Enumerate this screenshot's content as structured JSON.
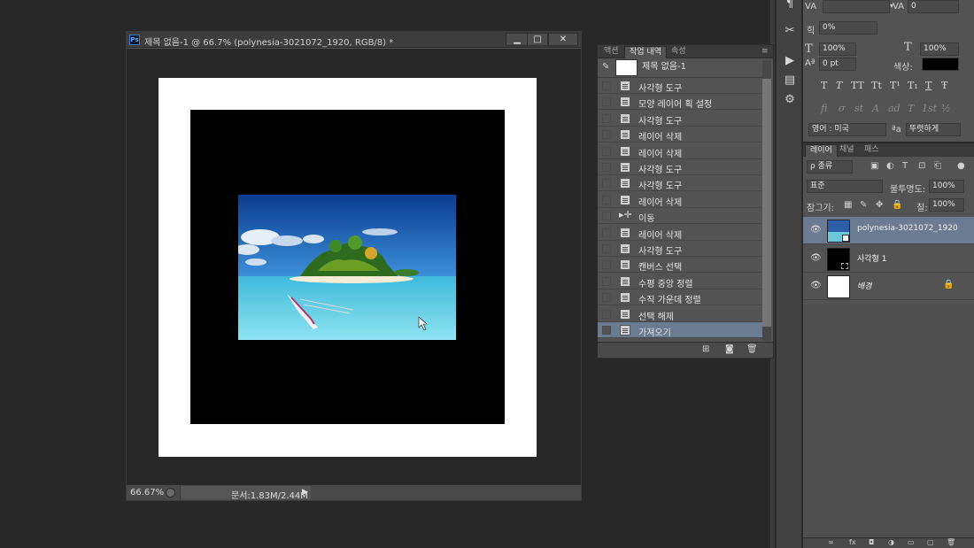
{
  "document": {
    "title": "제목 없음-1 @ 66.7% (polynesia-3021072_1920, RGB/8) *",
    "app_badge": "Ps",
    "minimize": "▁",
    "restore": "□",
    "close": "✕",
    "zoom": "66.67%",
    "doc_info": "문서:1.83M/2.44M",
    "status_arrow": "▶"
  },
  "history_panel": {
    "tabs": [
      "액션",
      "작업 내역",
      "속성"
    ],
    "active_tab": "작업 내역",
    "menu_icon": "≡",
    "snapshot_label": "제목 없음-1",
    "items": [
      {
        "label": "사각형 도구",
        "icon": "document-icon"
      },
      {
        "label": "모양 레이어 획 설정",
        "icon": "document-icon"
      },
      {
        "label": "사각형 도구",
        "icon": "document-icon"
      },
      {
        "label": "레이어 삭제",
        "icon": "document-icon"
      },
      {
        "label": "레이어 삭제",
        "icon": "document-icon"
      },
      {
        "label": "사각형 도구",
        "icon": "document-icon"
      },
      {
        "label": "사각형 도구",
        "icon": "document-icon"
      },
      {
        "label": "레이어 삭제",
        "icon": "document-icon"
      },
      {
        "label": "이동",
        "icon": "move-icon"
      },
      {
        "label": "레이어 삭제",
        "icon": "document-icon"
      },
      {
        "label": "사각형 도구",
        "icon": "document-icon"
      },
      {
        "label": "캔버스 선택",
        "icon": "document-icon"
      },
      {
        "label": "수평 중앙 정렬",
        "icon": "document-icon"
      },
      {
        "label": "수직 가운데 정렬",
        "icon": "document-icon"
      },
      {
        "label": "선택 해제",
        "icon": "document-icon"
      },
      {
        "label": "가져오기",
        "icon": "document-icon"
      }
    ],
    "selected_index": 15
  },
  "character_panel": {
    "tracking_label": "VA",
    "tracking_value": "0",
    "scale_percent": "0%",
    "vertical_scale": "100%",
    "horizontal_scale": "100%",
    "baseline_shift": "0 pt",
    "color_label": "색상:",
    "text_color": "#000000",
    "type_buttons": [
      "T",
      "T",
      "TT",
      "Tt",
      "T¹",
      "T₁",
      "T",
      "Ŧ"
    ],
    "opentype_buttons": [
      "fi",
      "σ",
      "st",
      "A",
      "ad",
      "T",
      "1st",
      "½"
    ],
    "language": "영어 : 미국",
    "aa_label": "ªa",
    "antialias": "뚜렷하게"
  },
  "layers_panel": {
    "tabs": [
      "레이어",
      "채널",
      "패스"
    ],
    "filter_label": "ρ 종류",
    "blend_mode": "표준",
    "opacity_label": "불투명도:",
    "opacity": "100%",
    "lock_label": "잠그기:",
    "fill_label": "칠:",
    "fill": "100%",
    "layers": [
      {
        "name": "polynesia-3021072_1920",
        "type": "smart-object",
        "visible": true,
        "selected": true
      },
      {
        "name": "사각형 1",
        "type": "shape",
        "visible": true,
        "selected": false
      },
      {
        "name": "배경",
        "type": "background",
        "visible": true,
        "selected": false,
        "locked": true
      }
    ],
    "footer_icons": [
      "link-icon",
      "fx-icon",
      "mask-icon",
      "adjustment-icon",
      "group-icon",
      "new-layer-icon",
      "trash-icon"
    ]
  },
  "tools": [
    "paragraph-icon",
    "tools-icon",
    "play-icon",
    "properties-icon",
    "clone-source-icon"
  ],
  "colors": {
    "selection": "#6b7c92",
    "canvas_white": "#ffffff",
    "canvas_black": "#000000"
  }
}
